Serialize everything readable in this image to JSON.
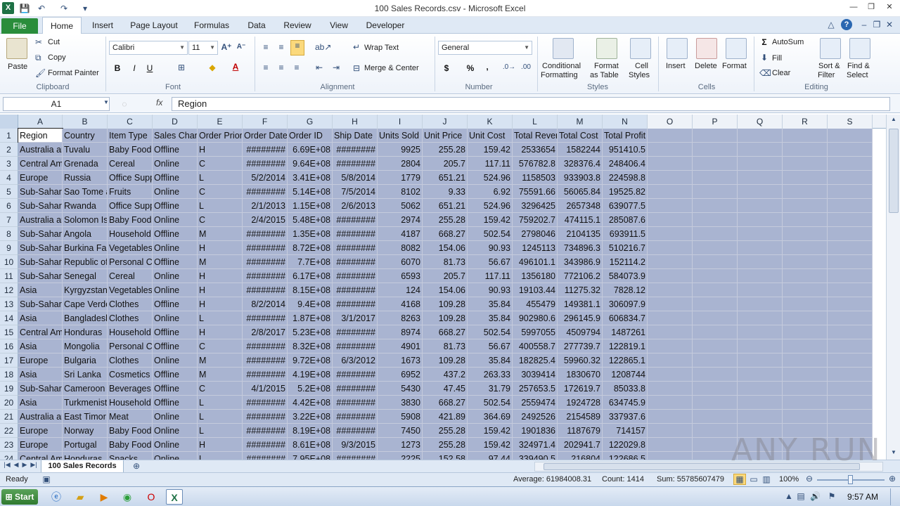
{
  "window": {
    "title": "100 Sales Records.csv - Microsoft Excel",
    "app_icon": "X"
  },
  "quick_access": {
    "save_icon": "💾",
    "undo_icon": "↶",
    "redo_icon": "↷",
    "customize_icon": "▾"
  },
  "tabs": [
    "File",
    "Home",
    "Insert",
    "Page Layout",
    "Formulas",
    "Data",
    "Review",
    "View",
    "Developer"
  ],
  "ribbon": {
    "clipboard": {
      "paste": "Paste",
      "cut": "Cut",
      "copy": "Copy",
      "format_painter": "Format Painter",
      "label": "Clipboard"
    },
    "font": {
      "name": "Calibri",
      "size": "11",
      "bold": "B",
      "italic": "I",
      "underline": "U",
      "label": "Font"
    },
    "alignment": {
      "wrap_text": "Wrap Text",
      "merge_center": "Merge & Center",
      "label": "Alignment"
    },
    "number": {
      "format": "General",
      "currency": "$",
      "percent": "%",
      "comma": ",",
      "label": "Number"
    },
    "styles": {
      "conditional": "Conditional",
      "conditional2": "Formatting",
      "format_table": "Format",
      "format_table2": "as Table",
      "cell_styles": "Cell",
      "cell_styles2": "Styles",
      "label": "Styles"
    },
    "cells": {
      "insert": "Insert",
      "delete": "Delete",
      "format": "Format",
      "label": "Cells"
    },
    "editing": {
      "autosum": "AutoSum",
      "fill": "Fill",
      "clear": "Clear",
      "sort": "Sort &",
      "sort2": "Filter",
      "find": "Find &",
      "find2": "Select",
      "label": "Editing"
    }
  },
  "formula_bar": {
    "name_box": "A1",
    "fx": "fx",
    "content": "Region"
  },
  "columns": [
    "A",
    "B",
    "C",
    "D",
    "E",
    "F",
    "G",
    "H",
    "I",
    "J",
    "K",
    "L",
    "M",
    "N",
    "O",
    "P",
    "Q",
    "R",
    "S"
  ],
  "rows": [
    {
      "n": "1",
      "c": [
        "Region",
        "Country",
        "Item Type",
        "Sales Channel",
        "Order Priority",
        "Order Date",
        "Order ID",
        "Ship Date",
        "Units Sold",
        "Unit Price",
        "Unit Cost",
        "Total Revenue",
        "Total Cost",
        "Total Profit"
      ]
    },
    {
      "n": "2",
      "c": [
        "Australia and Oceania",
        "Tuvalu",
        "Baby Food",
        "Offline",
        "H",
        "########",
        "6.69E+08",
        "########",
        "9925",
        "255.28",
        "159.42",
        "2533654",
        "1582244",
        "951410.5"
      ]
    },
    {
      "n": "3",
      "c": [
        "Central America and the Caribbean",
        "Grenada",
        "Cereal",
        "Online",
        "C",
        "########",
        "9.64E+08",
        "########",
        "2804",
        "205.7",
        "117.11",
        "576782.8",
        "328376.4",
        "248406.4"
      ]
    },
    {
      "n": "4",
      "c": [
        "Europe",
        "Russia",
        "Office Supplies",
        "Offline",
        "L",
        "5/2/2014",
        "3.41E+08",
        "5/8/2014",
        "1779",
        "651.21",
        "524.96",
        "1158503",
        "933903.8",
        "224598.8"
      ]
    },
    {
      "n": "5",
      "c": [
        "Sub-Saharan Africa",
        "Sao Tome and Principe",
        "Fruits",
        "Online",
        "C",
        "########",
        "5.14E+08",
        "7/5/2014",
        "8102",
        "9.33",
        "6.92",
        "75591.66",
        "56065.84",
        "19525.82"
      ]
    },
    {
      "n": "6",
      "c": [
        "Sub-Saharan Africa",
        "Rwanda",
        "Office Supplies",
        "Offline",
        "L",
        "2/1/2013",
        "1.15E+08",
        "2/6/2013",
        "5062",
        "651.21",
        "524.96",
        "3296425",
        "2657348",
        "639077.5"
      ]
    },
    {
      "n": "7",
      "c": [
        "Australia and Oceania",
        "Solomon Islands",
        "Baby Food",
        "Online",
        "C",
        "2/4/2015",
        "5.48E+08",
        "########",
        "2974",
        "255.28",
        "159.42",
        "759202.7",
        "474115.1",
        "285087.6"
      ]
    },
    {
      "n": "8",
      "c": [
        "Sub-Saharan Africa",
        "Angola",
        "Household",
        "Offline",
        "M",
        "########",
        "1.35E+08",
        "########",
        "4187",
        "668.27",
        "502.54",
        "2798046",
        "2104135",
        "693911.5"
      ]
    },
    {
      "n": "9",
      "c": [
        "Sub-Saharan Africa",
        "Burkina Faso",
        "Vegetables",
        "Online",
        "H",
        "########",
        "8.72E+08",
        "########",
        "8082",
        "154.06",
        "90.93",
        "1245113",
        "734896.3",
        "510216.7"
      ]
    },
    {
      "n": "10",
      "c": [
        "Sub-Saharan Africa",
        "Republic of the Congo",
        "Personal Care",
        "Offline",
        "M",
        "########",
        "7.7E+08",
        "########",
        "6070",
        "81.73",
        "56.67",
        "496101.1",
        "343986.9",
        "152114.2"
      ]
    },
    {
      "n": "11",
      "c": [
        "Sub-Saharan Africa",
        "Senegal",
        "Cereal",
        "Online",
        "H",
        "########",
        "6.17E+08",
        "########",
        "6593",
        "205.7",
        "117.11",
        "1356180",
        "772106.2",
        "584073.9"
      ]
    },
    {
      "n": "12",
      "c": [
        "Asia",
        "Kyrgyzstan",
        "Vegetables",
        "Online",
        "H",
        "########",
        "8.15E+08",
        "########",
        "124",
        "154.06",
        "90.93",
        "19103.44",
        "11275.32",
        "7828.12"
      ]
    },
    {
      "n": "13",
      "c": [
        "Sub-Saharan Africa",
        "Cape Verde",
        "Clothes",
        "Offline",
        "H",
        "8/2/2014",
        "9.4E+08",
        "########",
        "4168",
        "109.28",
        "35.84",
        "455479",
        "149381.1",
        "306097.9"
      ]
    },
    {
      "n": "14",
      "c": [
        "Asia",
        "Bangladesh",
        "Clothes",
        "Online",
        "L",
        "########",
        "1.87E+08",
        "3/1/2017",
        "8263",
        "109.28",
        "35.84",
        "902980.6",
        "296145.9",
        "606834.7"
      ]
    },
    {
      "n": "15",
      "c": [
        "Central America and the Caribbean",
        "Honduras",
        "Household",
        "Offline",
        "H",
        "2/8/2017",
        "5.23E+08",
        "########",
        "8974",
        "668.27",
        "502.54",
        "5997055",
        "4509794",
        "1487261"
      ]
    },
    {
      "n": "16",
      "c": [
        "Asia",
        "Mongolia",
        "Personal Care",
        "Offline",
        "C",
        "########",
        "8.32E+08",
        "########",
        "4901",
        "81.73",
        "56.67",
        "400558.7",
        "277739.7",
        "122819.1"
      ]
    },
    {
      "n": "17",
      "c": [
        "Europe",
        "Bulgaria",
        "Clothes",
        "Online",
        "M",
        "########",
        "9.72E+08",
        "6/3/2012",
        "1673",
        "109.28",
        "35.84",
        "182825.4",
        "59960.32",
        "122865.1"
      ]
    },
    {
      "n": "18",
      "c": [
        "Asia",
        "Sri Lanka",
        "Cosmetics",
        "Offline",
        "M",
        "########",
        "4.19E+08",
        "########",
        "6952",
        "437.2",
        "263.33",
        "3039414",
        "1830670",
        "1208744"
      ]
    },
    {
      "n": "19",
      "c": [
        "Sub-Saharan Africa",
        "Cameroon",
        "Beverages",
        "Offline",
        "C",
        "4/1/2015",
        "5.2E+08",
        "########",
        "5430",
        "47.45",
        "31.79",
        "257653.5",
        "172619.7",
        "85033.8"
      ]
    },
    {
      "n": "20",
      "c": [
        "Asia",
        "Turkmenistan",
        "Household",
        "Offline",
        "L",
        "########",
        "4.42E+08",
        "########",
        "3830",
        "668.27",
        "502.54",
        "2559474",
        "1924728",
        "634745.9"
      ]
    },
    {
      "n": "21",
      "c": [
        "Australia and Oceania",
        "East Timor",
        "Meat",
        "Online",
        "L",
        "########",
        "3.22E+08",
        "########",
        "5908",
        "421.89",
        "364.69",
        "2492526",
        "2154589",
        "337937.6"
      ]
    },
    {
      "n": "22",
      "c": [
        "Europe",
        "Norway",
        "Baby Food",
        "Online",
        "L",
        "########",
        "8.19E+08",
        "########",
        "7450",
        "255.28",
        "159.42",
        "1901836",
        "1187679",
        "714157"
      ]
    },
    {
      "n": "23",
      "c": [
        "Europe",
        "Portugal",
        "Baby Food",
        "Online",
        "H",
        "########",
        "8.61E+08",
        "9/3/2015",
        "1273",
        "255.28",
        "159.42",
        "324971.4",
        "202941.7",
        "122029.8"
      ]
    },
    {
      "n": "24",
      "c": [
        "Central America and the Caribbean",
        "Honduras",
        "Snacks",
        "Online",
        "L",
        "########",
        "7.95E+08",
        "########",
        "2225",
        "152.58",
        "97.44",
        "339490.5",
        "216804",
        "122686.5"
      ]
    }
  ],
  "sheet_tab": "100 Sales Records",
  "status": {
    "ready": "Ready",
    "average": "Average: 61984008.31",
    "count": "Count: 1414",
    "sum": "Sum: 55785607479",
    "zoom": "100%"
  },
  "taskbar": {
    "start": "Start",
    "time": "9:57 AM"
  },
  "watermark": "ANY RUN"
}
